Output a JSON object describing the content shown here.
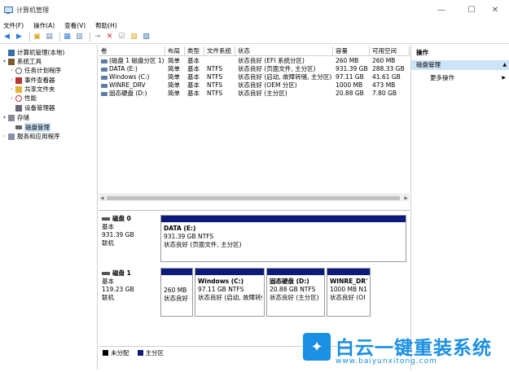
{
  "window": {
    "title": "计算机管理",
    "min": "—",
    "max": "☐",
    "close": "✕"
  },
  "menu": [
    "文件(F)",
    "操作(A)",
    "查看(V)",
    "帮助(H)"
  ],
  "tree": [
    {
      "label": "计算机管理(本地)",
      "indent": 0,
      "expander": "",
      "icon": "computer-icon"
    },
    {
      "label": "系统工具",
      "indent": 1,
      "expander": "▾",
      "icon": "tools-icon"
    },
    {
      "label": "任务计划程序",
      "indent": 2,
      "expander": "›",
      "icon": "clock-icon"
    },
    {
      "label": "事件查看器",
      "indent": 2,
      "expander": "›",
      "icon": "event-viewer-icon"
    },
    {
      "label": "共享文件夹",
      "indent": 2,
      "expander": "›",
      "icon": "folder-icon"
    },
    {
      "label": "性能",
      "indent": 2,
      "expander": "›",
      "icon": "performance-icon"
    },
    {
      "label": "设备管理器",
      "indent": 2,
      "expander": "",
      "icon": "device-manager-icon"
    },
    {
      "label": "存储",
      "indent": 1,
      "expander": "▾",
      "icon": "storage-icon"
    },
    {
      "label": "磁盘管理",
      "indent": 2,
      "expander": "",
      "icon": "disk-management-icon",
      "selected": true
    },
    {
      "label": "服务和应用程序",
      "indent": 1,
      "expander": "›",
      "icon": "services-icon"
    }
  ],
  "volume_table": {
    "headers": [
      "卷",
      "布局",
      "类型",
      "文件系统",
      "状态",
      "容量",
      "可用空间"
    ],
    "rows": [
      [
        "(磁盘 1 磁盘分区 1)",
        "简单",
        "基本",
        "",
        "状态良好 (EFI 系统分区)",
        "260 MB",
        "260 MB"
      ],
      [
        "DATA (E:)",
        "简单",
        "基本",
        "NTFS",
        "状态良好 (页面文件, 主分区)",
        "931.39 GB",
        "288.33 GB"
      ],
      [
        "Windows (C:)",
        "简单",
        "基本",
        "NTFS",
        "状态良好 (启动, 故障转储, 主分区)",
        "97.11 GB",
        "41.61 GB"
      ],
      [
        "WINRE_DRV",
        "简单",
        "基本",
        "NTFS",
        "状态良好 (OEM 分区)",
        "1000 MB",
        "473 MB"
      ],
      [
        "固态硬盘 (D:)",
        "简单",
        "基本",
        "NTFS",
        "状态良好 (主分区)",
        "20.88 GB",
        "7.80 GB"
      ]
    ]
  },
  "disks": [
    {
      "name": "磁盘 0",
      "type": "基本",
      "size": "931.39 GB",
      "status": "联机",
      "partitions": [
        {
          "name": "DATA  (E:)",
          "size": "931.39 GB NTFS",
          "status": "状态良好 (页面文件, 主分区)"
        }
      ]
    },
    {
      "name": "磁盘 1",
      "type": "基本",
      "size": "119.23 GB",
      "status": "联机",
      "partitions": [
        {
          "name": "",
          "size": "260 MB",
          "status": "状态良好"
        },
        {
          "name": "Windows  (C:)",
          "size": "97.11 GB NTFS",
          "status": "状态良好 (启动, 故障转储"
        },
        {
          "name": "固态硬盘 (D:)",
          "size": "20.88 GB NTFS",
          "status": "状态良好 (主分区)"
        },
        {
          "name": "WINRE_DR'",
          "size": "1000 MB N1",
          "status": "状态良好 (OI"
        }
      ]
    }
  ],
  "legend": [
    {
      "label": "未分配",
      "color": "#000000"
    },
    {
      "label": "主分区",
      "color": "#0c1a7a"
    }
  ],
  "actions": {
    "header": "操作",
    "section": "磁盘管理",
    "more": "更多操作"
  },
  "watermark": {
    "brand": "白云一键重装系统",
    "url": "www.baiyunxitong.com"
  }
}
